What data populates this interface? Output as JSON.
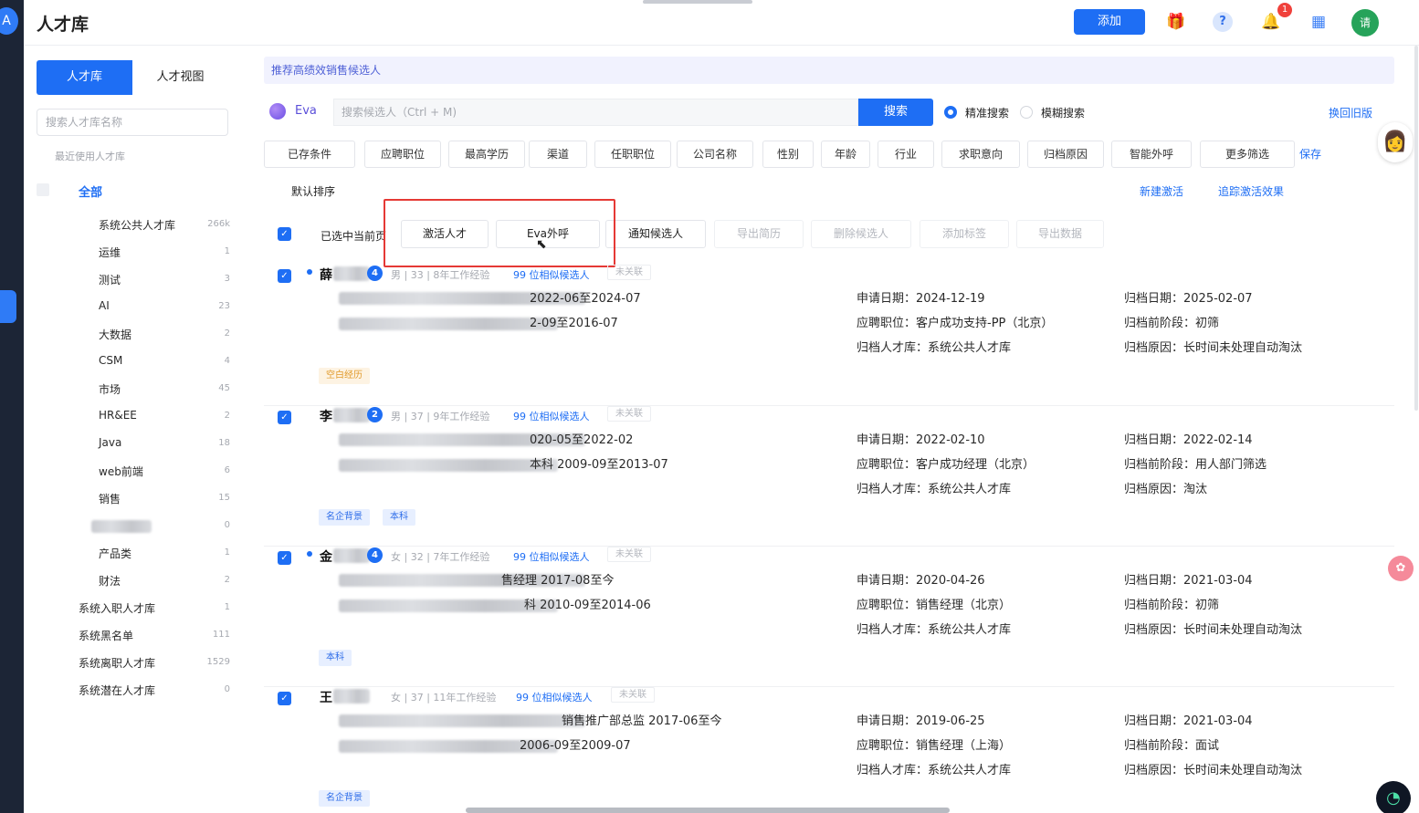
{
  "app": {
    "title": "人才库",
    "logo": "A"
  },
  "topbar": {
    "add_label": "添加",
    "notification_count": "1",
    "avatar_text": "请",
    "help_glyph": "?"
  },
  "sidebar": {
    "tabs": [
      "人才库",
      "人才视图"
    ],
    "search_placeholder": "搜索人才库名称",
    "recent_label": "最近使用人才库",
    "all_label": "全部",
    "sub_items": [
      {
        "label": "系统公共人才库",
        "count": "266k"
      },
      {
        "label": "运维",
        "count": "1"
      },
      {
        "label": "测试",
        "count": "3"
      },
      {
        "label": "AI",
        "count": "23"
      },
      {
        "label": "大数据",
        "count": "2"
      },
      {
        "label": "CSM",
        "count": "4"
      },
      {
        "label": "市场",
        "count": "45"
      },
      {
        "label": "HR&EE",
        "count": "2"
      },
      {
        "label": "Java",
        "count": "18"
      },
      {
        "label": "web前端",
        "count": "6"
      },
      {
        "label": "销售",
        "count": "15"
      },
      {
        "label": "",
        "count": "0"
      },
      {
        "label": "产品类",
        "count": "1"
      },
      {
        "label": "财法",
        "count": "2"
      }
    ],
    "top_items": [
      {
        "label": "系统入职人才库",
        "count": "1"
      },
      {
        "label": "系统黑名单",
        "count": "111"
      },
      {
        "label": "系统离职人才库",
        "count": "1529"
      },
      {
        "label": "系统潜在人才库",
        "count": "0"
      }
    ]
  },
  "main": {
    "banner": "推荐高绩效销售候选人",
    "eva_label": "Eva",
    "search_placeholder": "搜索候选人（Ctrl + M)",
    "search_button": "搜索",
    "radio_exact": "精准搜索",
    "radio_fuzzy": "模糊搜索",
    "old_version": "换回旧版",
    "filters": [
      "已存条件",
      "应聘职位",
      "最高学历",
      "渠道",
      "任职职位",
      "公司名称",
      "性别",
      "年龄",
      "行业",
      "求职意向",
      "归档原因",
      "智能外呼",
      "更多筛选"
    ],
    "save": "保存",
    "sort": "默认排序",
    "new_activation": "新建激活",
    "track_activation": "追踪激活效果",
    "select_current": "已选中当前页",
    "actions": [
      "激活人才",
      "Eva外呼",
      "通知候选人",
      "导出简历",
      "删除候选人",
      "添加标签",
      "导出数据"
    ],
    "actions_disabled": [
      false,
      false,
      false,
      true,
      true,
      true,
      true
    ]
  },
  "candidates": [
    {
      "name": "薛",
      "count": "4",
      "meta": "男 | 33 | 8年工作经验",
      "similar": "99 位相似候选人",
      "unlinked": "未关联",
      "line1": "2022-06至2024-07",
      "line2": "2-09至2016-07",
      "apply_date": "申请日期：2024-12-19",
      "position": "应聘职位：客户成功支持-PP（北京）",
      "pool": "归档人才库：系统公共人才库",
      "archive_date": "归档日期：2025-02-07",
      "stage": "归档前阶段：初筛",
      "reason": "归档原因：长时间未处理自动淘汰",
      "tags": [
        {
          "text": "空白经历",
          "style": "orange"
        }
      ]
    },
    {
      "name": "李",
      "count": "2",
      "meta": "男 | 37 | 9年工作经验",
      "similar": "99 位相似候选人",
      "unlinked": "未关联",
      "line1": "020-05至2022-02",
      "line2": "本科  2009-09至2013-07",
      "apply_date": "申请日期：2022-02-10",
      "position": "应聘职位：客户成功经理（北京）",
      "pool": "归档人才库：系统公共人才库",
      "archive_date": "归档日期：2022-02-14",
      "stage": "归档前阶段：用人部门筛选",
      "reason": "归档原因：淘汰",
      "tags": [
        {
          "text": "名企背景",
          "style": "blue"
        },
        {
          "text": "本科",
          "style": "blue"
        }
      ]
    },
    {
      "name": "金",
      "count": "4",
      "meta": "女 | 32 | 7年工作经验",
      "similar": "99 位相似候选人",
      "unlinked": "未关联",
      "line1": "售经理  2017-08至今",
      "line2": "科  2010-09至2014-06",
      "apply_date": "申请日期：2020-04-26",
      "position": "应聘职位：销售经理（北京）",
      "pool": "归档人才库：系统公共人才库",
      "archive_date": "归档日期：2021-03-04",
      "stage": "归档前阶段：初筛",
      "reason": "归档原因：长时间未处理自动淘汰",
      "tags": [
        {
          "text": "本科",
          "style": "blue"
        }
      ]
    },
    {
      "name": "王",
      "count": "",
      "meta": "女 | 37 | 11年工作经验",
      "similar": "99 位相似候选人",
      "unlinked": "未关联",
      "line1": "销售推广部总监  2017-06至今",
      "line2": "2006-09至2009-07",
      "apply_date": "申请日期：2019-06-25",
      "position": "应聘职位：销售经理（上海）",
      "pool": "归档人才库：系统公共人才库",
      "archive_date": "归档日期：2021-03-04",
      "stage": "归档前阶段：面试",
      "reason": "归档原因：长时间未处理自动淘汰",
      "tags": [
        {
          "text": "名企背景",
          "style": "blue"
        }
      ]
    }
  ]
}
